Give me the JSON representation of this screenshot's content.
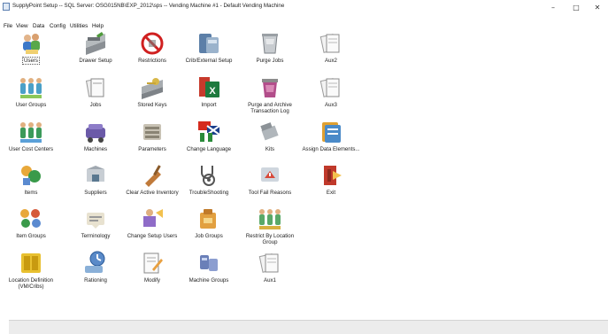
{
  "window": {
    "title": "SupplyPoint Setup -- SQL Server: OSG015NB\\EXP_2012\\sps -- Vending Machine #1 - Default Vending Machine",
    "minimize": "–",
    "maximize": "□",
    "close": "✕"
  },
  "menu": [
    "File",
    "View",
    "Data",
    "Config",
    "Utilities",
    "Help"
  ],
  "tiles": [
    {
      "label": "Users",
      "icon": "users-icon"
    },
    {
      "label": "Drawer Setup",
      "icon": "drawer-setup-icon"
    },
    {
      "label": "Restrictions",
      "icon": "restrictions-icon"
    },
    {
      "label": "Crib/External Setup",
      "icon": "crib-external-icon"
    },
    {
      "label": "Purge Jobs",
      "icon": "purge-jobs-icon"
    },
    {
      "label": "Aux2",
      "icon": "aux2-icon"
    },
    {
      "label": "User Groups",
      "icon": "user-groups-icon"
    },
    {
      "label": "Jobs",
      "icon": "jobs-icon"
    },
    {
      "label": "Stored Keys",
      "icon": "stored-keys-icon"
    },
    {
      "label": "Import",
      "icon": "import-icon"
    },
    {
      "label": "Purge and Archive Transaction Log",
      "icon": "purge-archive-icon"
    },
    {
      "label": "Aux3",
      "icon": "aux3-icon"
    },
    {
      "label": "User Cost Centers",
      "icon": "user-cost-centers-icon"
    },
    {
      "label": "Machines",
      "icon": "machines-icon"
    },
    {
      "label": "Parameters",
      "icon": "parameters-icon"
    },
    {
      "label": "Change Language",
      "icon": "change-language-icon"
    },
    {
      "label": "Kits",
      "icon": "kits-icon"
    },
    {
      "label": "Assign Data Elements...",
      "icon": "assign-data-elements-icon"
    },
    {
      "label": "Items",
      "icon": "items-icon"
    },
    {
      "label": "Suppliers",
      "icon": "suppliers-icon"
    },
    {
      "label": "Clear Active Inventory",
      "icon": "clear-inventory-icon"
    },
    {
      "label": "TroubleShooting",
      "icon": "troubleshooting-icon"
    },
    {
      "label": "Tool Fail Reasons",
      "icon": "tool-fail-reasons-icon"
    },
    {
      "label": "Exit",
      "icon": "exit-icon"
    },
    {
      "label": "Item Groups",
      "icon": "item-groups-icon"
    },
    {
      "label": "Terminology",
      "icon": "terminology-icon"
    },
    {
      "label": "Change Setup Users",
      "icon": "change-setup-users-icon"
    },
    {
      "label": "Job Groups",
      "icon": "job-groups-icon"
    },
    {
      "label": "Restrict By Location Group",
      "icon": "restrict-location-icon"
    },
    {
      "label": "Location Definition (VM/Cribs)",
      "icon": "location-definition-icon"
    },
    {
      "label": "Rationing",
      "icon": "rationing-icon"
    },
    {
      "label": "Modify",
      "icon": "modify-icon"
    },
    {
      "label": "Machine Groups",
      "icon": "machine-groups-icon"
    },
    {
      "label": "Aux1",
      "icon": "aux1-icon"
    }
  ]
}
